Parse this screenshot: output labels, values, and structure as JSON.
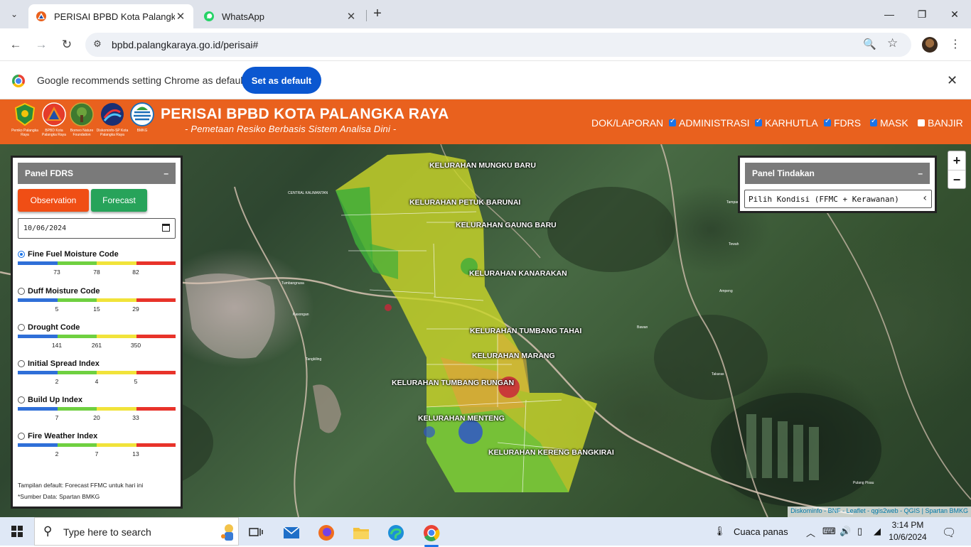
{
  "browser": {
    "tabs": [
      {
        "title": "PERISAI BPBD Kota Palangka Ra",
        "active": true,
        "favicon": "bpbd-logo-icon"
      },
      {
        "title": "WhatsApp",
        "active": false,
        "favicon": "whatsapp-icon"
      }
    ],
    "url": "bpbd.palangkaraya.go.id/perisai#"
  },
  "infobar": {
    "message": "Google recommends setting Chrome as default",
    "button": "Set as default"
  },
  "header": {
    "title": "PERISAI BPBD KOTA PALANGKA RAYA",
    "subtitle": "- Pemetaan Resiko Berbasis Sistem Analisa Dini -",
    "logos": [
      {
        "caption": "Pemko Palangka Raya"
      },
      {
        "caption": "BPBD Kota Palangka Raya"
      },
      {
        "caption": "Borneo Nature Foundation"
      },
      {
        "caption": "Diskominfo-SP Kota Palangka Raya"
      },
      {
        "caption": "BMKG"
      }
    ],
    "nav": [
      {
        "label": "DOK/LAPORAN",
        "checkbox": false,
        "checked": false
      },
      {
        "label": "ADMINISTRASI",
        "checkbox": true,
        "checked": true
      },
      {
        "label": "KARHUTLA",
        "checkbox": true,
        "checked": true
      },
      {
        "label": "FDRS",
        "checkbox": true,
        "checked": true
      },
      {
        "label": "MASK",
        "checkbox": true,
        "checked": true
      },
      {
        "label": "BANJIR",
        "checkbox": true,
        "checked": false
      }
    ]
  },
  "panel_fdrs": {
    "title": "Panel FDRS",
    "collapse": "–",
    "observation": "Observation",
    "forecast": "Forecast",
    "date": "10/06/2024",
    "scale_colors": [
      "#2f6fd8",
      "#6fd040",
      "#f1e33a",
      "#e8332a"
    ],
    "indices": [
      {
        "label": "Fine Fuel Moisture Code",
        "selected": true,
        "ticks": [
          "73",
          "78",
          "82"
        ]
      },
      {
        "label": "Duff Moisture Code",
        "selected": false,
        "ticks": [
          "5",
          "15",
          "29"
        ]
      },
      {
        "label": "Drought Code",
        "selected": false,
        "ticks": [
          "141",
          "261",
          "350"
        ]
      },
      {
        "label": "Initial Spread Index",
        "selected": false,
        "ticks": [
          "2",
          "4",
          "5"
        ]
      },
      {
        "label": "Build Up Index",
        "selected": false,
        "ticks": [
          "7",
          "20",
          "33"
        ]
      },
      {
        "label": "Fire Weather Index",
        "selected": false,
        "ticks": [
          "2",
          "7",
          "13"
        ]
      }
    ],
    "note1": "Tampilan default: Forecast FFMC untuk hari ini",
    "note2": "*Sumber Data: Spartan BMKG"
  },
  "panel_tindakan": {
    "title": "Panel Tindakan",
    "collapse": "–",
    "select_value": "Pilih Kondisi (FFMC + Kerawanan)"
  },
  "map": {
    "zoom_in": "+",
    "zoom_out": "−",
    "attribution": "Diskominfo - BNF - Leaflet - qgis2web - QGIS | Spartan BMKG",
    "kelurahan": [
      "KELURAHAN MUNGKU BARU",
      "KELURAHAN PETUK BARUNAI",
      "KELURAHAN GAUNG BARU",
      "KELURAHAN KANARAKAN",
      "KELURAHAN TUMBANG TAHAI",
      "KELURAHAN MARANG",
      "KELURAHAN TUMBANG RUNGAN",
      "KELURAHAN MENTENG",
      "KELURAHAN KERENG BANGKIRAI"
    ],
    "places": [
      "CENTRAL KALIMANTAN",
      "Tumbangnusa",
      "Tangkiling",
      "Kasongan",
      "Bawan",
      "Ampeng",
      "Tampang",
      "Tewah",
      "Takaras",
      "Pulang Pisau"
    ]
  },
  "taskbar": {
    "search_placeholder": "Type here to search",
    "weather": "Cuaca panas",
    "time": "3:14 PM",
    "date": "10/6/2024"
  }
}
